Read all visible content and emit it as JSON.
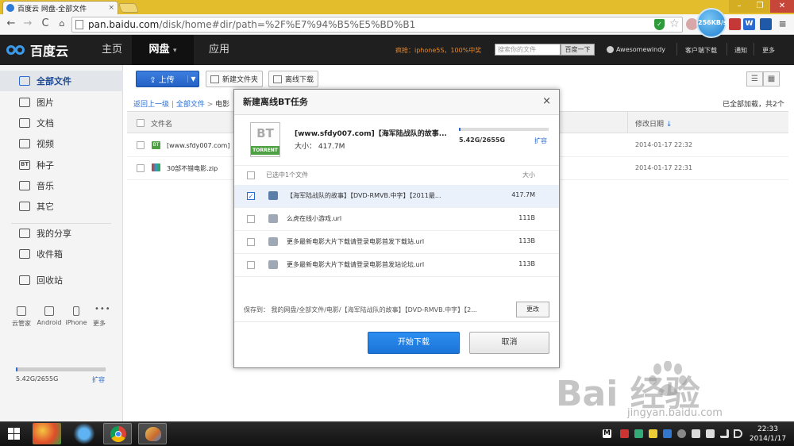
{
  "browser": {
    "tab_title": "百度云 网盘-全部文件",
    "tab_close": "×",
    "url_host": "pan.baidu.com",
    "url_path": "/disk/home#dir/path=%2F%E7%94%B5%E5%BD%B1",
    "speed": "256KB/s",
    "back": "←",
    "forward": "→",
    "reload": "C",
    "star": "☆",
    "shield": "✓",
    "win_min": "–",
    "win_max": "❐",
    "win_close": "✕",
    "ext_w": "W"
  },
  "nav": {
    "logo": "百度云",
    "home": "主页",
    "disk": "网盘",
    "disk_arrow": "▾",
    "apps": "应用",
    "promo": "疯抢：iphone5S，100%中奖",
    "search_placeholder": "搜索你的文件",
    "search_button": "百度一下",
    "username": "Awesomewindy",
    "client": "客户端下载",
    "notify": "通知",
    "more": "更多"
  },
  "sidebar": {
    "items": [
      {
        "label": "全部文件",
        "icon": "cloud-icon"
      },
      {
        "label": "图片",
        "icon": "image-icon"
      },
      {
        "label": "文档",
        "icon": "document-icon"
      },
      {
        "label": "视频",
        "icon": "video-icon"
      },
      {
        "label": "种子",
        "icon": "bt-icon",
        "glyph": "BT"
      },
      {
        "label": "音乐",
        "icon": "music-icon"
      },
      {
        "label": "其它",
        "icon": "other-icon"
      },
      {
        "label": "我的分享",
        "icon": "share-icon"
      },
      {
        "label": "收件箱",
        "icon": "inbox-icon"
      },
      {
        "label": "回收站",
        "icon": "trash-icon"
      }
    ],
    "devices": [
      "云管家",
      "Android",
      "iPhone",
      "更多"
    ],
    "quota_used_gb": 5.42,
    "quota_total_gb": 2655,
    "quota_text": "5.42G/2655G",
    "expand": "扩容"
  },
  "toolbar": {
    "upload": "上传",
    "upload_arrow": "▼",
    "new_folder": "新建文件夹",
    "offline_download": "离线下载",
    "list_view": "☰",
    "grid_view": "▦"
  },
  "breadcrumb": {
    "back": "返回上一级",
    "sep1": "|",
    "all": "全部文件",
    "sep2": ">",
    "current": "电影"
  },
  "loaded_text": "已全部加载，共2个",
  "file_list": {
    "col_name": "文件名",
    "col_date": "修改日期",
    "sort_arrow": "↓",
    "rows": [
      {
        "name": "[www.sfdy007.com]【",
        "date": "2014-01-17 22:32",
        "icon": "bt-file-icon",
        "icon_glyph": "BT"
      },
      {
        "name": "30部不错电影.zip",
        "date": "2014-01-17 22:31",
        "icon": "zip-file-icon"
      }
    ]
  },
  "dialog": {
    "title": "新建离线BT任务",
    "close": "×",
    "torrent_bt": "BT",
    "torrent_label": "TORRENT",
    "torrent_name": "[www.sfdy007.com]【海军陆战队的故事...",
    "torrent_size": "大小： 417.7M",
    "capacity_used_gb": 5.42,
    "capacity_total_gb": 2655,
    "capacity_text": "5.42G/2655G",
    "expand": "扩容",
    "selected_count": "已选中1个文件",
    "size_header": "大小",
    "check_mark": "✓",
    "files": [
      {
        "name": "【海军陆战队的故事】【DVD-RMVB.中字】【2011最...",
        "size": "417.7M",
        "checked": true,
        "icon": "video-file-icon"
      },
      {
        "name": "么虎在线小游戏.url",
        "size": "111B",
        "checked": false,
        "icon": "url-file-icon"
      },
      {
        "name": "更多最新电影大片下载请登录电影首发下载站.url",
        "size": "113B",
        "checked": false,
        "icon": "url-file-icon"
      },
      {
        "name": "更多最新电影大片下载请登录电影首发站论坛.url",
        "size": "113B",
        "checked": false,
        "icon": "url-file-icon"
      }
    ],
    "save_to": "保存到： 我的网盘/全部文件/电影/【海军陆战队的故事】【DVD-RMVB.中字】【2...",
    "change": "更改",
    "start": "开始下载",
    "cancel": "取消"
  },
  "watermark": {
    "text": "Bai   经验",
    "url": "jingyan.baidu.com"
  },
  "taskbar": {
    "time": "22:33",
    "date": "2014/1/17",
    "tray_m": "M"
  }
}
